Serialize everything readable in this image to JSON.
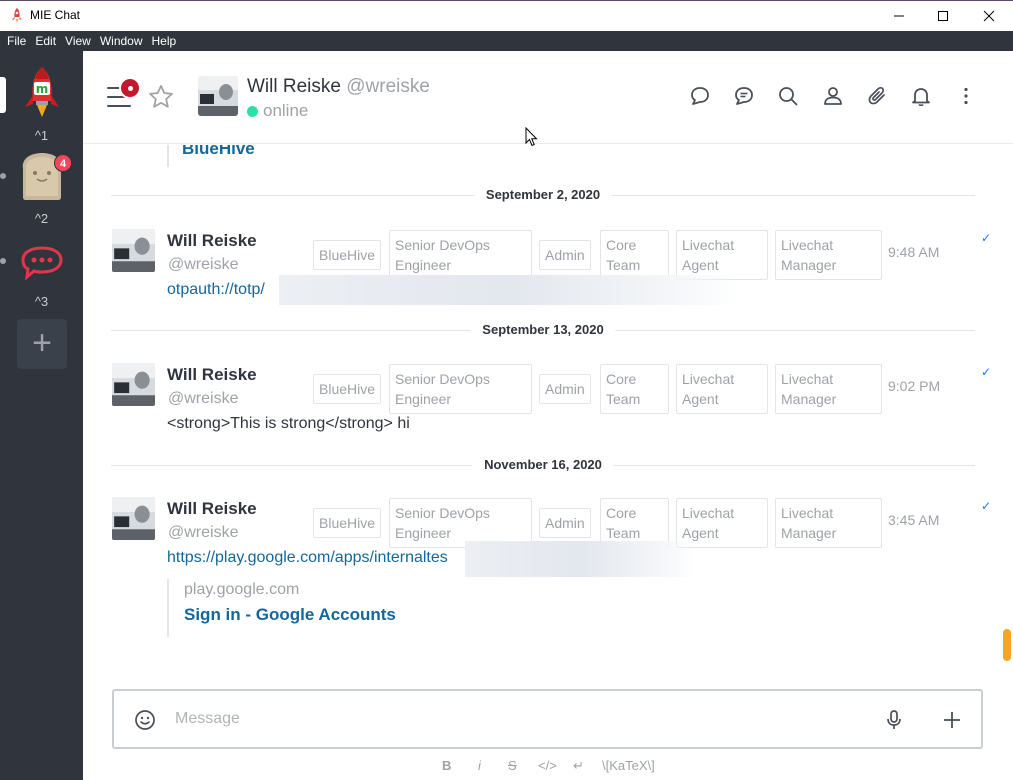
{
  "window": {
    "title": "MIE Chat"
  },
  "menu": [
    "File",
    "Edit",
    "View",
    "Window",
    "Help"
  ],
  "servers": [
    {
      "shortcut": "^1",
      "badge": ""
    },
    {
      "shortcut": "^2",
      "badge": "4"
    },
    {
      "shortcut": "^3",
      "badge": ""
    }
  ],
  "header": {
    "name": "Will Reiske",
    "handle": "@wreiske",
    "status": "online",
    "icons": [
      "discussion-icon",
      "threads-icon",
      "search-icon",
      "user-info-icon",
      "attachment-icon",
      "notifications-icon",
      "kebab-menu-icon"
    ]
  },
  "previous_message_tail": "BlueHive",
  "messages": [
    {
      "date": "September 2, 2020",
      "name": "Will Reiske",
      "handle": "@wreiske",
      "roles": [
        "BlueHive",
        "Senior DevOps Engineer",
        "Admin",
        "Core Team",
        "Livechat Agent",
        "Livechat Manager"
      ],
      "time": "9:48 AM",
      "body": "otpauth://totp/"
    },
    {
      "date": "September 13, 2020",
      "name": "Will Reiske",
      "handle": "@wreiske",
      "roles": [
        "BlueHive",
        "Senior DevOps Engineer",
        "Admin",
        "Core Team",
        "Livechat Agent",
        "Livechat Manager"
      ],
      "time": "9:02 PM",
      "body": "<strong>This is strong</strong> hi"
    },
    {
      "date": "November 16, 2020",
      "name": "Will Reiske",
      "handle": "@wreiske",
      "roles": [
        "BlueHive",
        "Senior DevOps Engineer",
        "Admin",
        "Core Team",
        "Livechat Agent",
        "Livechat Manager"
      ],
      "time": "3:45 AM",
      "body": "https://play.google.com/apps/internaltes",
      "preview": {
        "host": "play.google.com",
        "title": "Sign in - Google Accounts"
      }
    }
  ],
  "composer": {
    "placeholder": "Message",
    "formatting": [
      "B",
      "i",
      "S",
      "</>",
      "↵",
      "\\[KaTeX\\]"
    ]
  },
  "colors": {
    "sidebar": "#2f343d",
    "link": "#13679a",
    "online": "#2de0a5",
    "badge": "#f5455c",
    "check": "#1d74f5"
  }
}
